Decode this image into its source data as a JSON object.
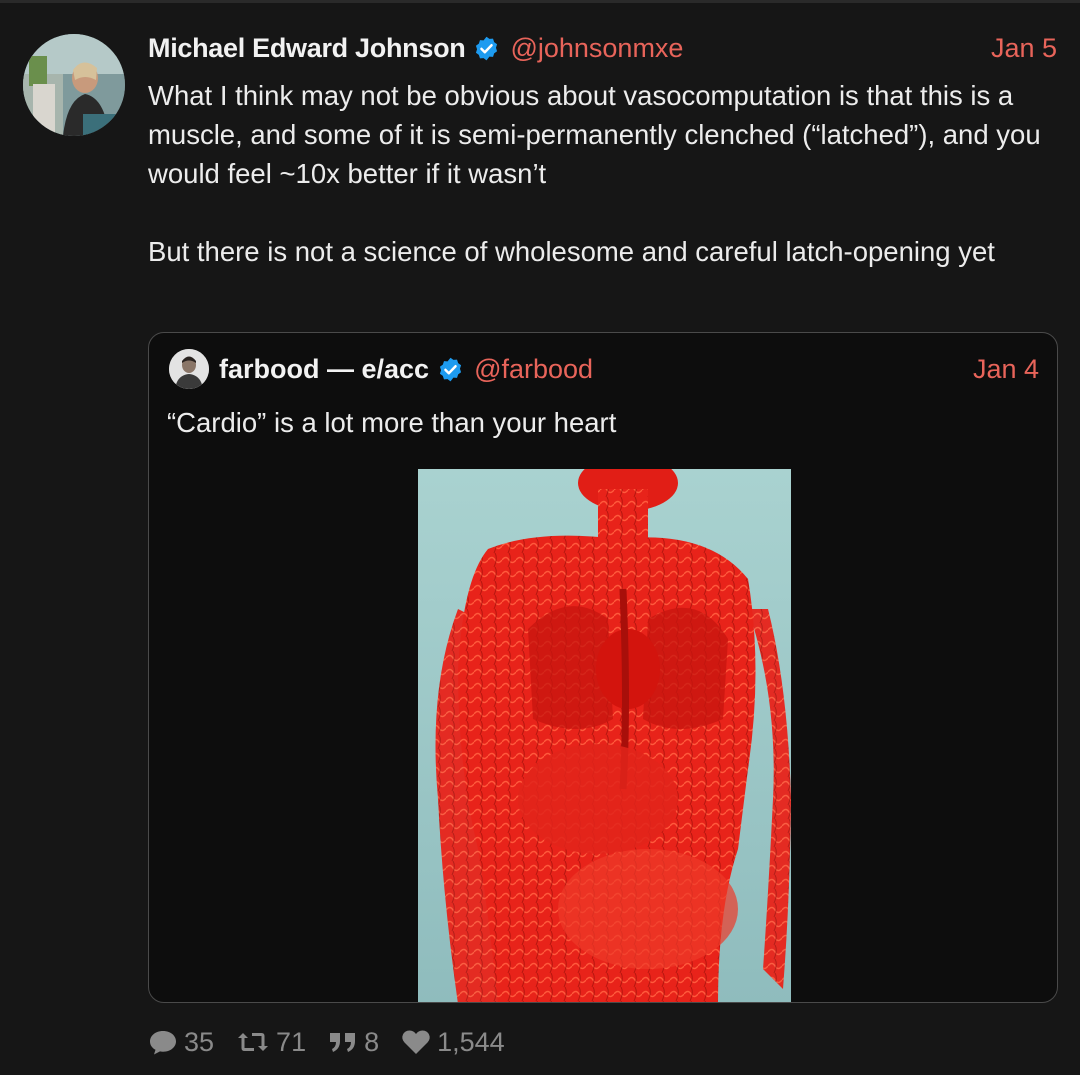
{
  "tweet": {
    "author_name": "Michael Edward Johnson",
    "handle": "@johnsonmxe",
    "date": "Jan 5",
    "paragraphs": [
      "What I think may not be obvious about vasocomputation is that this is a muscle, and some of it is semi-permanently clenched (“latched”), and you would feel ~10x better if it wasn’t",
      "But there is not a science of wholesome and careful latch-opening yet"
    ]
  },
  "quote": {
    "author_name": "farbood — e/acc",
    "handle": "@farbood",
    "date": "Jan 4",
    "text": "“Cardio” is a lot more than your heart"
  },
  "actions": {
    "replies": "35",
    "retweets": "71",
    "quotes": "8",
    "likes": "1,544"
  },
  "icons": {
    "verified": "verified-badge-icon",
    "reply": "speech-bubble-icon",
    "retweet": "retweet-icon",
    "quote": "quote-marks-icon",
    "like": "heart-icon"
  },
  "colors": {
    "background": "#161616",
    "accent": "#e8645a",
    "verified": "#1d9bf0",
    "muted": "#8a8a8a",
    "text": "#ececec"
  }
}
